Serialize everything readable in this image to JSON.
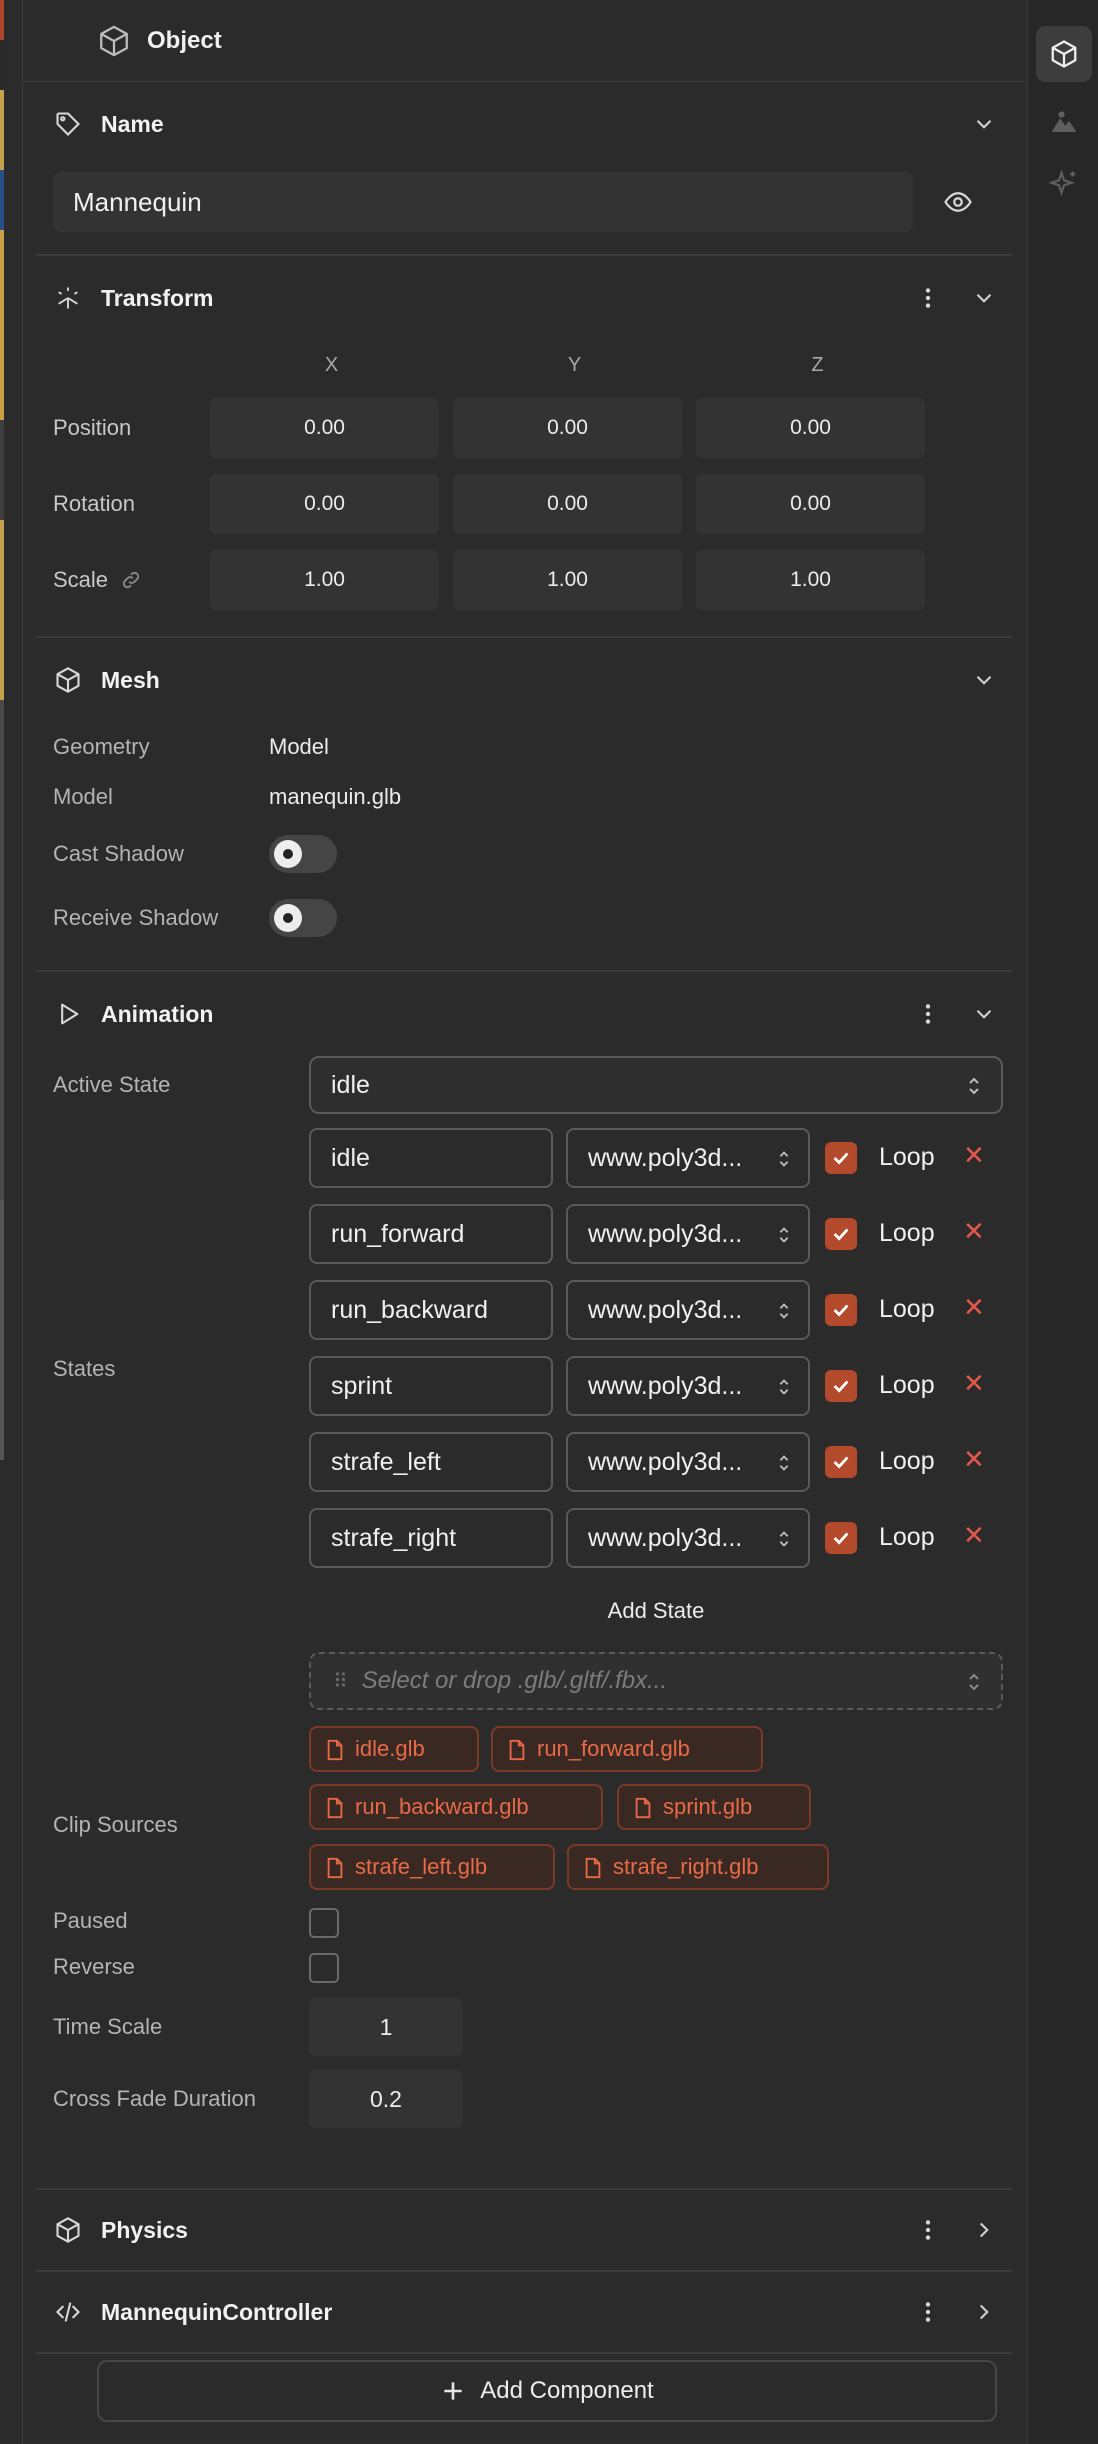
{
  "header": {
    "title": "Object"
  },
  "name_section": {
    "title": "Name",
    "value": "Mannequin"
  },
  "transform": {
    "title": "Transform",
    "axes": [
      "X",
      "Y",
      "Z"
    ],
    "rows": [
      {
        "label": "Position",
        "values": [
          "0.00",
          "0.00",
          "0.00"
        ]
      },
      {
        "label": "Rotation",
        "values": [
          "0.00",
          "0.00",
          "0.00"
        ]
      },
      {
        "label": "Scale",
        "values": [
          "1.00",
          "1.00",
          "1.00"
        ]
      }
    ]
  },
  "mesh": {
    "title": "Mesh",
    "geometry_label": "Geometry",
    "geometry_value": "Model",
    "model_label": "Model",
    "model_value": "manequin.glb",
    "cast_shadow_label": "Cast Shadow",
    "receive_shadow_label": "Receive Shadow"
  },
  "animation": {
    "title": "Animation",
    "active_state_label": "Active State",
    "active_state_value": "idle",
    "states_label": "States",
    "loop_label": "Loop",
    "remove_glyph": "✕",
    "states": [
      {
        "name": "idle",
        "source": "www.poly3d..."
      },
      {
        "name": "run_forward",
        "source": "www.poly3d..."
      },
      {
        "name": "run_backward",
        "source": "www.poly3d..."
      },
      {
        "name": "sprint",
        "source": "www.poly3d..."
      },
      {
        "name": "strafe_left",
        "source": "www.poly3d..."
      },
      {
        "name": "strafe_right",
        "source": "www.poly3d..."
      }
    ],
    "add_state_label": "Add State",
    "drop_placeholder": "Select or drop .glb/.gltf/.fbx...",
    "clip_sources_label": "Clip Sources",
    "clips": [
      "idle.glb",
      "run_forward.glb",
      "run_backward.glb",
      "sprint.glb",
      "strafe_left.glb",
      "strafe_right.glb"
    ],
    "paused_label": "Paused",
    "reverse_label": "Reverse",
    "time_scale_label": "Time Scale",
    "time_scale_value": "1",
    "cross_fade_label": "Cross Fade Duration",
    "cross_fade_value": "0.2"
  },
  "physics": {
    "title": "Physics"
  },
  "controller": {
    "title": "MannequinController"
  },
  "add_component_label": "Add Component",
  "colors": {
    "accent": "#b34a2c",
    "chip_text": "#e86a47",
    "panel_bg": "#2b2b2b"
  }
}
